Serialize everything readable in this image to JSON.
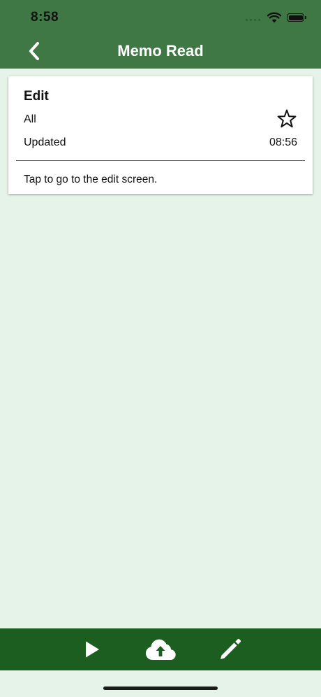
{
  "status_bar": {
    "time": "8:58"
  },
  "nav": {
    "title": "Memo Read",
    "back_icon": "chevron-left-icon"
  },
  "memo": {
    "title": "Edit",
    "category": "All",
    "updated_label": "Updated",
    "updated_time": "08:56",
    "hint": "Tap to go to the edit screen.",
    "favorite_icon": "star-outline-icon",
    "favorited": false
  },
  "toolbar": {
    "items": [
      {
        "icon": "play-icon"
      },
      {
        "icon": "cloud-upload-icon"
      },
      {
        "icon": "pencil-icon"
      }
    ]
  },
  "colors": {
    "header": "#3f7844",
    "toolbar": "#1b5e20",
    "background": "#e6f3e8",
    "card": "#ffffff"
  }
}
